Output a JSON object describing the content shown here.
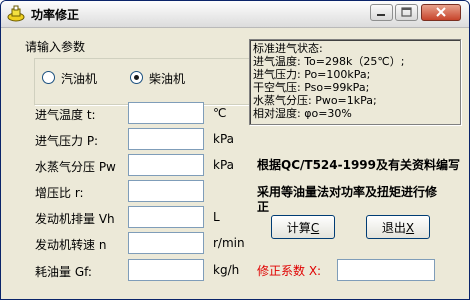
{
  "window": {
    "title": "功率修正"
  },
  "input_group": {
    "title": "请输入参数",
    "options": [
      {
        "label": "汽油机",
        "selected": false
      },
      {
        "label": "柴油机",
        "selected": true
      }
    ]
  },
  "inputs": [
    {
      "label": "进气温度 t:",
      "unit": "℃",
      "value": ""
    },
    {
      "label": "进气压力 P:",
      "unit": "kPa",
      "value": ""
    },
    {
      "label": "水蒸气分压 Pw",
      "unit": "kPa",
      "value": ""
    },
    {
      "label": "增压比 r:",
      "unit": "",
      "value": ""
    },
    {
      "label": "发动机排量 Vh",
      "unit": "L",
      "value": ""
    },
    {
      "label": "发动机转速 n",
      "unit": "r/min",
      "value": ""
    },
    {
      "label": "耗油量 Gf:",
      "unit": "kg/h",
      "value": ""
    }
  ],
  "standard_conditions": {
    "lines": [
      "标准进气状态:",
      "进气温度: To=298k（25℃）;",
      "进气压力: Po=100kPa;",
      "干空气压: Pso=99kPa;",
      "水蒸气分压: Pwo=1kPa;",
      "相对湿度: φo=30%"
    ]
  },
  "notes": {
    "standard": "根据QC/T524-1999及有关资料编写",
    "method_line1": "采用等油量法对功率及扭矩进行修",
    "method_line2": "正"
  },
  "buttons": {
    "calculate": {
      "label": "计算",
      "key": "C"
    },
    "exit": {
      "label": "退出",
      "key": "X"
    }
  },
  "correction": {
    "label": "修正系数 X:",
    "value": ""
  }
}
